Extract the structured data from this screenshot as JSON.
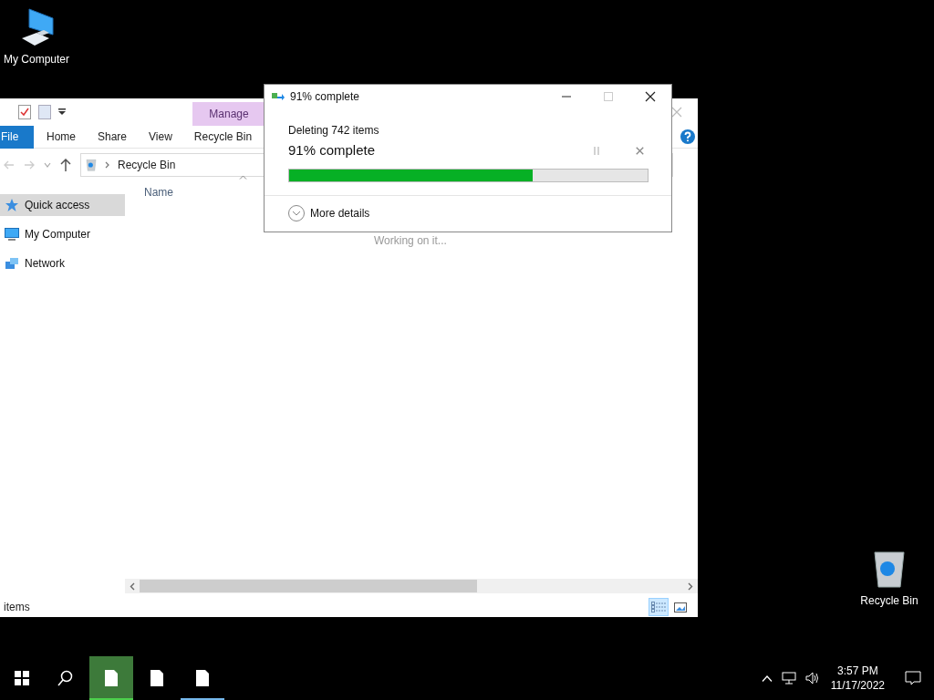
{
  "desktop_icons": [
    {
      "kind": "computer",
      "label": "My Computer"
    },
    {
      "kind": "recycle",
      "label": "Recycle Bin"
    }
  ],
  "explorer": {
    "context_tab": "Manage",
    "ribbon_tabs": [
      {
        "label": "File",
        "kind": "file",
        "selected": false
      },
      {
        "label": "Home",
        "kind": "tab",
        "selected": false
      },
      {
        "label": "Share",
        "kind": "tab",
        "selected": false
      },
      {
        "label": "View",
        "kind": "tab",
        "selected": false
      },
      {
        "label": "Recycle Bin",
        "kind": "tab",
        "selected": false
      }
    ],
    "address": "Recycle Bin",
    "column": "Name",
    "status_message": "Working on it...",
    "sidebar": [
      {
        "label": "Quick access",
        "kind": "star",
        "selected": true
      },
      {
        "label": "My Computer",
        "kind": "computer",
        "selected": false
      },
      {
        "label": "Network",
        "kind": "network",
        "selected": false
      }
    ],
    "status_bar": "items",
    "views": [
      {
        "kind": "details",
        "selected": true
      },
      {
        "kind": "large",
        "selected": false
      }
    ]
  },
  "dialog": {
    "title": "91% complete",
    "operation": "Deleting 742 items",
    "progress_text": "91% complete",
    "level": 0.68,
    "more": "More details"
  },
  "taskbar": {
    "items": [
      {
        "selected": true,
        "running": true
      },
      {
        "selected": false,
        "running": false
      },
      {
        "selected": false,
        "running": true
      }
    ],
    "time": "3:57 PM",
    "date": "11/17/2022"
  }
}
